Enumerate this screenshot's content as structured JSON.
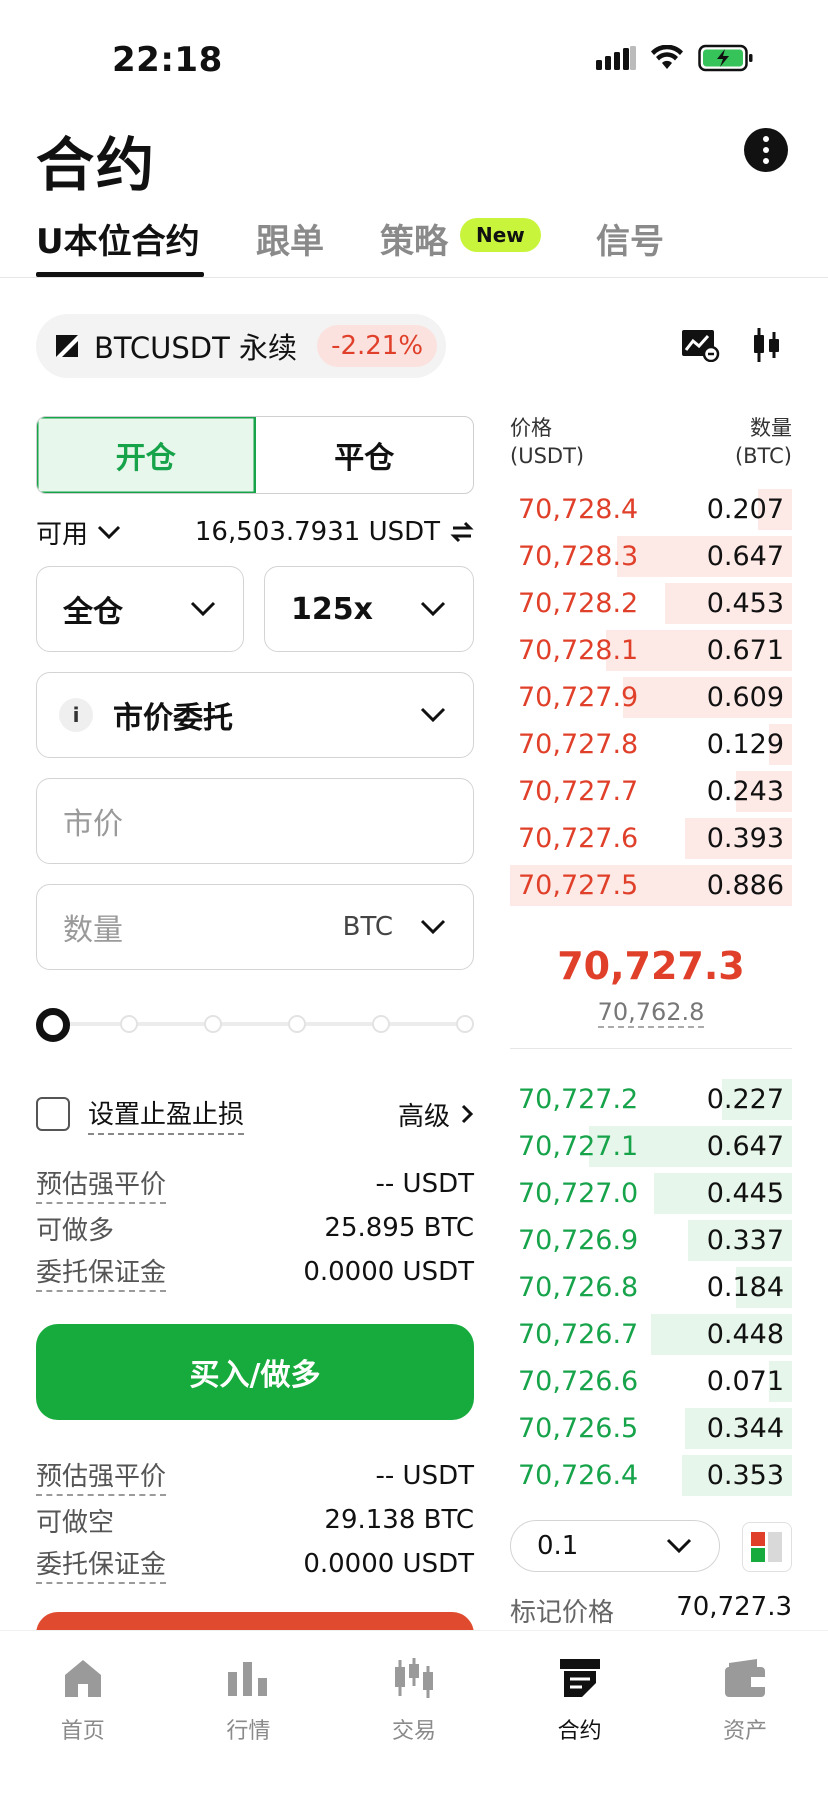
{
  "status_bar": {
    "time": "22:18"
  },
  "header": {
    "title": "合约"
  },
  "tabs": [
    {
      "label": "U本位合约",
      "active": true
    },
    {
      "label": "跟单",
      "active": false
    },
    {
      "label": "策略",
      "active": false,
      "badge": "New"
    },
    {
      "label": "信号",
      "active": false
    }
  ],
  "symbol": {
    "name": "BTCUSDT 永续",
    "change": "-2.21%"
  },
  "order_form": {
    "open_label": "开仓",
    "close_label": "平仓",
    "available_label": "可用",
    "available_value": "16,503.7931 USDT",
    "margin_mode": "全仓",
    "leverage": "125x",
    "order_type": "市价委托",
    "order_type_info": "i",
    "price_placeholder": "市价",
    "qty_placeholder": "数量",
    "qty_unit": "BTC",
    "slider_percent": 0,
    "tpsl_label": "设置止盈止损",
    "advanced_label": "高级",
    "long_info": [
      {
        "label": "预估强平价",
        "value": "-- USDT"
      },
      {
        "label": "可做多",
        "value": "25.895 BTC"
      },
      {
        "label": "委托保证金",
        "value": "0.0000 USDT"
      }
    ],
    "buy_label": "买入/做多",
    "short_info": [
      {
        "label": "预估强平价",
        "value": "-- USDT"
      },
      {
        "label": "可做空",
        "value": "29.138 BTC"
      },
      {
        "label": "委托保证金",
        "value": "0.0000 USDT"
      }
    ]
  },
  "order_book": {
    "price_header": "价格",
    "price_unit": "(USDT)",
    "qty_header": "数量",
    "qty_unit": "(BTC)",
    "asks": [
      {
        "price": "70,728.4",
        "qty": "0.207",
        "depth": 0.12
      },
      {
        "price": "70,728.3",
        "qty": "0.647",
        "depth": 0.62
      },
      {
        "price": "70,728.2",
        "qty": "0.453",
        "depth": 0.45
      },
      {
        "price": "70,728.1",
        "qty": "0.671",
        "depth": 0.66
      },
      {
        "price": "70,727.9",
        "qty": "0.609",
        "depth": 0.6
      },
      {
        "price": "70,727.8",
        "qty": "0.129",
        "depth": 0.08
      },
      {
        "price": "70,727.7",
        "qty": "0.243",
        "depth": 0.2
      },
      {
        "price": "70,727.6",
        "qty": "0.393",
        "depth": 0.38
      },
      {
        "price": "70,727.5",
        "qty": "0.886",
        "depth": 1.0
      }
    ],
    "last_price": "70,727.3",
    "mark_price": "70,762.8",
    "bids": [
      {
        "price": "70,727.2",
        "qty": "0.227",
        "depth": 0.25
      },
      {
        "price": "70,727.1",
        "qty": "0.647",
        "depth": 0.72
      },
      {
        "price": "70,727.0",
        "qty": "0.445",
        "depth": 0.49
      },
      {
        "price": "70,726.9",
        "qty": "0.337",
        "depth": 0.37
      },
      {
        "price": "70,726.8",
        "qty": "0.184",
        "depth": 0.2
      },
      {
        "price": "70,726.7",
        "qty": "0.448",
        "depth": 0.5
      },
      {
        "price": "70,726.6",
        "qty": "0.071",
        "depth": 0.08
      },
      {
        "price": "70,726.5",
        "qty": "0.344",
        "depth": 0.38
      },
      {
        "price": "70,726.4",
        "qty": "0.353",
        "depth": 0.39
      }
    ],
    "depth_step": "0.1",
    "mark_label": "标记价格",
    "mark_value": "70,727.3"
  },
  "bottom_nav": [
    {
      "label": "首页",
      "icon": "home-icon",
      "active": false
    },
    {
      "label": "行情",
      "icon": "market-icon",
      "active": false
    },
    {
      "label": "交易",
      "icon": "trade-icon",
      "active": false
    },
    {
      "label": "合约",
      "icon": "futures-icon",
      "active": true
    },
    {
      "label": "资产",
      "icon": "wallet-icon",
      "active": false
    }
  ],
  "colors": {
    "buy": "#16ab3c",
    "sell": "#e0402a",
    "new_badge": "#c8f53c"
  }
}
